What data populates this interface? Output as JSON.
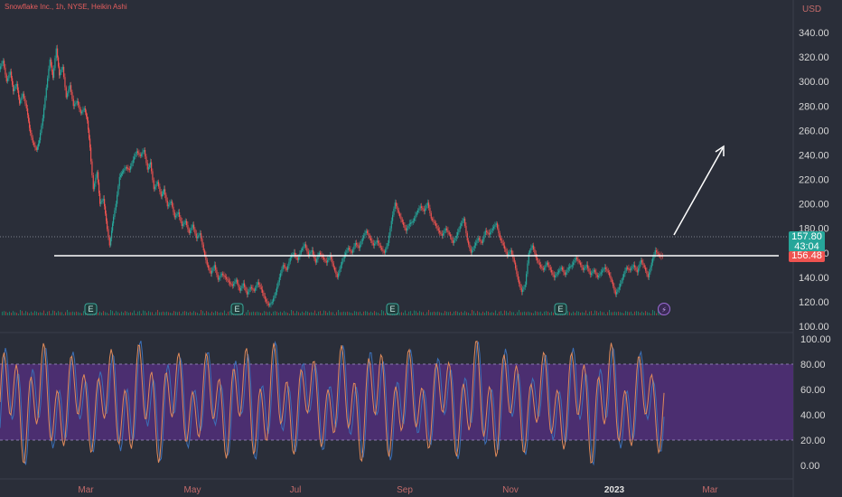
{
  "header": {
    "title": "Snowflake Inc., 1h, NYSE, Heikin Ashi"
  },
  "price_axis": {
    "currency": "USD",
    "ticks": [
      "340.00",
      "320.00",
      "300.00",
      "280.00",
      "260.00",
      "240.00",
      "220.00",
      "200.00",
      "180.00",
      "160.00",
      "140.00",
      "120.00",
      "100.00"
    ]
  },
  "oscillator_axis": {
    "ticks": [
      "100.00",
      "80.00",
      "60.00",
      "40.00",
      "20.00",
      "0.00"
    ]
  },
  "time_axis": {
    "labels": [
      "Mar",
      "May",
      "Jul",
      "Sep",
      "Nov",
      "2023",
      "Mar"
    ]
  },
  "price_tags": {
    "last": "157.80",
    "countdown": "43:04",
    "prev": "156.48"
  },
  "event_markers": {
    "earnings": [
      "E",
      "E",
      "E",
      "E"
    ],
    "flash": "⚡"
  },
  "colors": {
    "background": "#2a2e39",
    "up": "#26a69a",
    "down": "#ef5350",
    "band": "#4f2f77",
    "stoch_k": "#e08a5a",
    "stoch_d": "#3b6fb6",
    "support_line": "#ffffff"
  },
  "chart_data": {
    "type": "line",
    "title": "Snowflake Inc., 1h, NYSE, Heikin Ashi",
    "ylabel": "USD",
    "ylim": [
      100,
      350
    ],
    "grid": false,
    "x_labels": [
      "Mar",
      "May",
      "Jul",
      "Sep",
      "Nov",
      "2023",
      "Mar"
    ],
    "series": [
      {
        "values": [
          [
            0,
            310
          ],
          [
            4,
            317
          ],
          [
            8,
            300
          ],
          [
            12,
            308
          ],
          [
            15,
            292
          ],
          [
            19,
            298
          ],
          [
            22,
            282
          ],
          [
            26,
            290
          ],
          [
            30,
            278
          ],
          [
            33,
            262
          ],
          [
            37,
            250
          ],
          [
            41,
            244
          ],
          [
            44,
            252
          ],
          [
            48,
            270
          ],
          [
            52,
            295
          ],
          [
            56,
            318
          ],
          [
            59,
            303
          ],
          [
            63,
            327
          ],
          [
            66,
            305
          ],
          [
            70,
            312
          ],
          [
            74,
            287
          ],
          [
            78,
            297
          ],
          [
            82,
            280
          ],
          [
            86,
            284
          ],
          [
            90,
            274
          ],
          [
            94,
            278
          ],
          [
            97,
            268
          ],
          [
            100,
            246
          ],
          [
            104,
            212
          ],
          [
            108,
            226
          ],
          [
            111,
            200
          ],
          [
            115,
            204
          ],
          [
            118,
            186
          ],
          [
            122,
            166
          ],
          [
            125,
            184
          ],
          [
            129,
            200
          ],
          [
            133,
            222
          ],
          [
            136,
            226
          ],
          [
            140,
            230
          ],
          [
            144,
            228
          ],
          [
            148,
            236
          ],
          [
            152,
            243
          ],
          [
            156,
            239
          ],
          [
            160,
            244
          ],
          [
            164,
            228
          ],
          [
            167,
            234
          ],
          [
            171,
            212
          ],
          [
            175,
            218
          ],
          [
            179,
            206
          ],
          [
            182,
            212
          ],
          [
            186,
            198
          ],
          [
            190,
            202
          ],
          [
            194,
            189
          ],
          [
            198,
            193
          ],
          [
            202,
            182
          ],
          [
            206,
            186
          ],
          [
            210,
            176
          ],
          [
            214,
            183
          ],
          [
            218,
            172
          ],
          [
            222,
            176
          ],
          [
            226,
            162
          ],
          [
            230,
            150
          ],
          [
            234,
            143
          ],
          [
            238,
            150
          ],
          [
            242,
            138
          ],
          [
            246,
            143
          ],
          [
            250,
            140
          ],
          [
            254,
            136
          ],
          [
            258,
            133
          ],
          [
            262,
            138
          ],
          [
            266,
            129
          ],
          [
            270,
            135
          ],
          [
            274,
            126
          ],
          [
            278,
            132
          ],
          [
            282,
            129
          ],
          [
            286,
            136
          ],
          [
            290,
            130
          ],
          [
            294,
            122
          ],
          [
            298,
            117
          ],
          [
            302,
            120
          ],
          [
            306,
            128
          ],
          [
            310,
            140
          ],
          [
            314,
            150
          ],
          [
            318,
            146
          ],
          [
            322,
            156
          ],
          [
            326,
            160
          ],
          [
            330,
            154
          ],
          [
            334,
            162
          ],
          [
            338,
            167
          ],
          [
            342,
            158
          ],
          [
            346,
            162
          ],
          [
            350,
            152
          ],
          [
            354,
            160
          ],
          [
            358,
            156
          ],
          [
            362,
            152
          ],
          [
            366,
            158
          ],
          [
            370,
            148
          ],
          [
            374,
            140
          ],
          [
            378,
            150
          ],
          [
            382,
            158
          ],
          [
            386,
            164
          ],
          [
            390,
            160
          ],
          [
            394,
            168
          ],
          [
            398,
            164
          ],
          [
            402,
            172
          ],
          [
            406,
            178
          ],
          [
            410,
            172
          ],
          [
            414,
            166
          ],
          [
            418,
            170
          ],
          [
            422,
            164
          ],
          [
            426,
            160
          ],
          [
            430,
            168
          ],
          [
            434,
            186
          ],
          [
            438,
            201
          ],
          [
            442,
            192
          ],
          [
            446,
            185
          ],
          [
            450,
            178
          ],
          [
            454,
            184
          ],
          [
            458,
            186
          ],
          [
            462,
            193
          ],
          [
            466,
            198
          ],
          [
            470,
            194
          ],
          [
            474,
            201
          ],
          [
            478,
            188
          ],
          [
            482,
            184
          ],
          [
            486,
            178
          ],
          [
            490,
            174
          ],
          [
            494,
            180
          ],
          [
            498,
            175
          ],
          [
            502,
            168
          ],
          [
            506,
            174
          ],
          [
            510,
            182
          ],
          [
            514,
            188
          ],
          [
            518,
            170
          ],
          [
            522,
            160
          ],
          [
            526,
            166
          ],
          [
            530,
            172
          ],
          [
            534,
            168
          ],
          [
            538,
            178
          ],
          [
            542,
            175
          ],
          [
            546,
            180
          ],
          [
            550,
            184
          ],
          [
            554,
            172
          ],
          [
            558,
            166
          ],
          [
            562,
            158
          ],
          [
            566,
            162
          ],
          [
            570,
            152
          ],
          [
            574,
            138
          ],
          [
            578,
            128
          ],
          [
            582,
            134
          ],
          [
            586,
            160
          ],
          [
            590,
            166
          ],
          [
            594,
            156
          ],
          [
            598,
            150
          ],
          [
            602,
            146
          ],
          [
            606,
            152
          ],
          [
            610,
            146
          ],
          [
            614,
            140
          ],
          [
            618,
            144
          ],
          [
            622,
            148
          ],
          [
            626,
            142
          ],
          [
            630,
            148
          ],
          [
            634,
            150
          ],
          [
            638,
            156
          ],
          [
            642,
            152
          ],
          [
            646,
            146
          ],
          [
            650,
            150
          ],
          [
            654,
            142
          ],
          [
            658,
            146
          ],
          [
            662,
            140
          ],
          [
            666,
            144
          ],
          [
            670,
            148
          ],
          [
            674,
            144
          ],
          [
            678,
            136
          ],
          [
            682,
            126
          ],
          [
            686,
            132
          ],
          [
            690,
            140
          ],
          [
            694,
            148
          ],
          [
            698,
            146
          ],
          [
            702,
            150
          ],
          [
            706,
            144
          ],
          [
            710,
            154
          ],
          [
            714,
            148
          ],
          [
            718,
            140
          ],
          [
            722,
            152
          ],
          [
            726,
            162
          ],
          [
            730,
            158
          ],
          [
            734,
            157.8
          ]
        ]
      }
    ],
    "annotations": {
      "support_line_price": 147,
      "last_price": 157.8,
      "prev_close": 156.48
    },
    "volume": {
      "note_values_relative": [
        3,
        5,
        4,
        6,
        2,
        7,
        3,
        4,
        5,
        2,
        3,
        8,
        4,
        3,
        5,
        6,
        2,
        3,
        4,
        5,
        7,
        3,
        2,
        4,
        6,
        3,
        5,
        4,
        2,
        6,
        8,
        3,
        4,
        5,
        3,
        2,
        4,
        6,
        5,
        3,
        7,
        4,
        3,
        5,
        2,
        4,
        6,
        3,
        5,
        4
      ]
    },
    "oscillator": {
      "ylim": [
        -10,
        110
      ],
      "band": [
        20,
        80
      ],
      "type": "stochastic"
    }
  }
}
